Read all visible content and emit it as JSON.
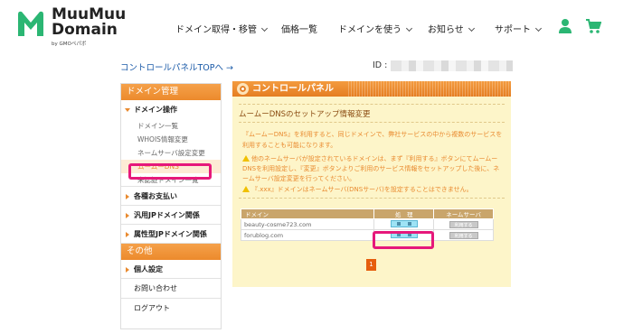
{
  "brand": {
    "name_line1": "MuuMuu",
    "name_line2": "Domain",
    "sub": "by GMOペパボ",
    "mark_color": "#2bb673"
  },
  "nav": [
    {
      "label": "ドメイン取得・移管",
      "chevron": true
    },
    {
      "label": "価格一覧",
      "chevron": false
    },
    {
      "label": "ドメインを使う",
      "chevron": true
    },
    {
      "label": "お知らせ",
      "chevron": true
    },
    {
      "label": "サポート",
      "chevron": true
    }
  ],
  "header_icons": {
    "user": "user-icon",
    "cart": "cart-icon",
    "color": "#2bb673"
  },
  "topbar": {
    "control_panel_link": "コントロールパネルTOPへ →",
    "id_label": "ID :"
  },
  "sidebar": {
    "domain_header": "ドメイン管理",
    "domain_ops": "ドメイン操作",
    "sub_items": [
      "ドメイン一覧",
      "WHOIS情報変更",
      "ネームサーバ設定変更",
      "ムームーDNS",
      "未認証ドメイン一覧"
    ],
    "active_sub_index": 3,
    "groups": [
      "各種お支払い",
      "汎用JPドメイン関係",
      "属性型JPドメイン関係"
    ],
    "other_header": "その他",
    "personal": "個人設定",
    "contact": "お問い合わせ",
    "logout": "ログアウト"
  },
  "panel": {
    "title": "コントロールパネル",
    "subtitle": "ムームーDNSのセットアップ情報変更",
    "description": "『ムームーDNS』を利用すると、同じドメインで、弊社サービスの中から複数のサービスを利用することも可能になります。",
    "warning1": "他のネームサーバが設定されているドメインは、まず『利用する』ボタンにてムームーDNSを利用設定し、『変更』ボタンよりご利用のサービス情報をセットアップした後に、ネームサーバ設定変更を行ってください。",
    "warning2": "『.xxx』ドメインはネームサーバ(DNSサーバ)を設定することはできません。"
  },
  "table": {
    "headers": [
      "ドメイン",
      "処　理",
      "ネームサーバ"
    ],
    "rows": [
      {
        "domain": "beauty-cosme723.com",
        "ns_button": "利用する"
      },
      {
        "domain": "forublog.com",
        "ns_button": "利用する"
      }
    ]
  },
  "pager": {
    "current": "1"
  },
  "colors": {
    "accent_orange": "#ec8a2c",
    "highlight": "#e6187b",
    "panel_bg": "#fdf5c9"
  }
}
